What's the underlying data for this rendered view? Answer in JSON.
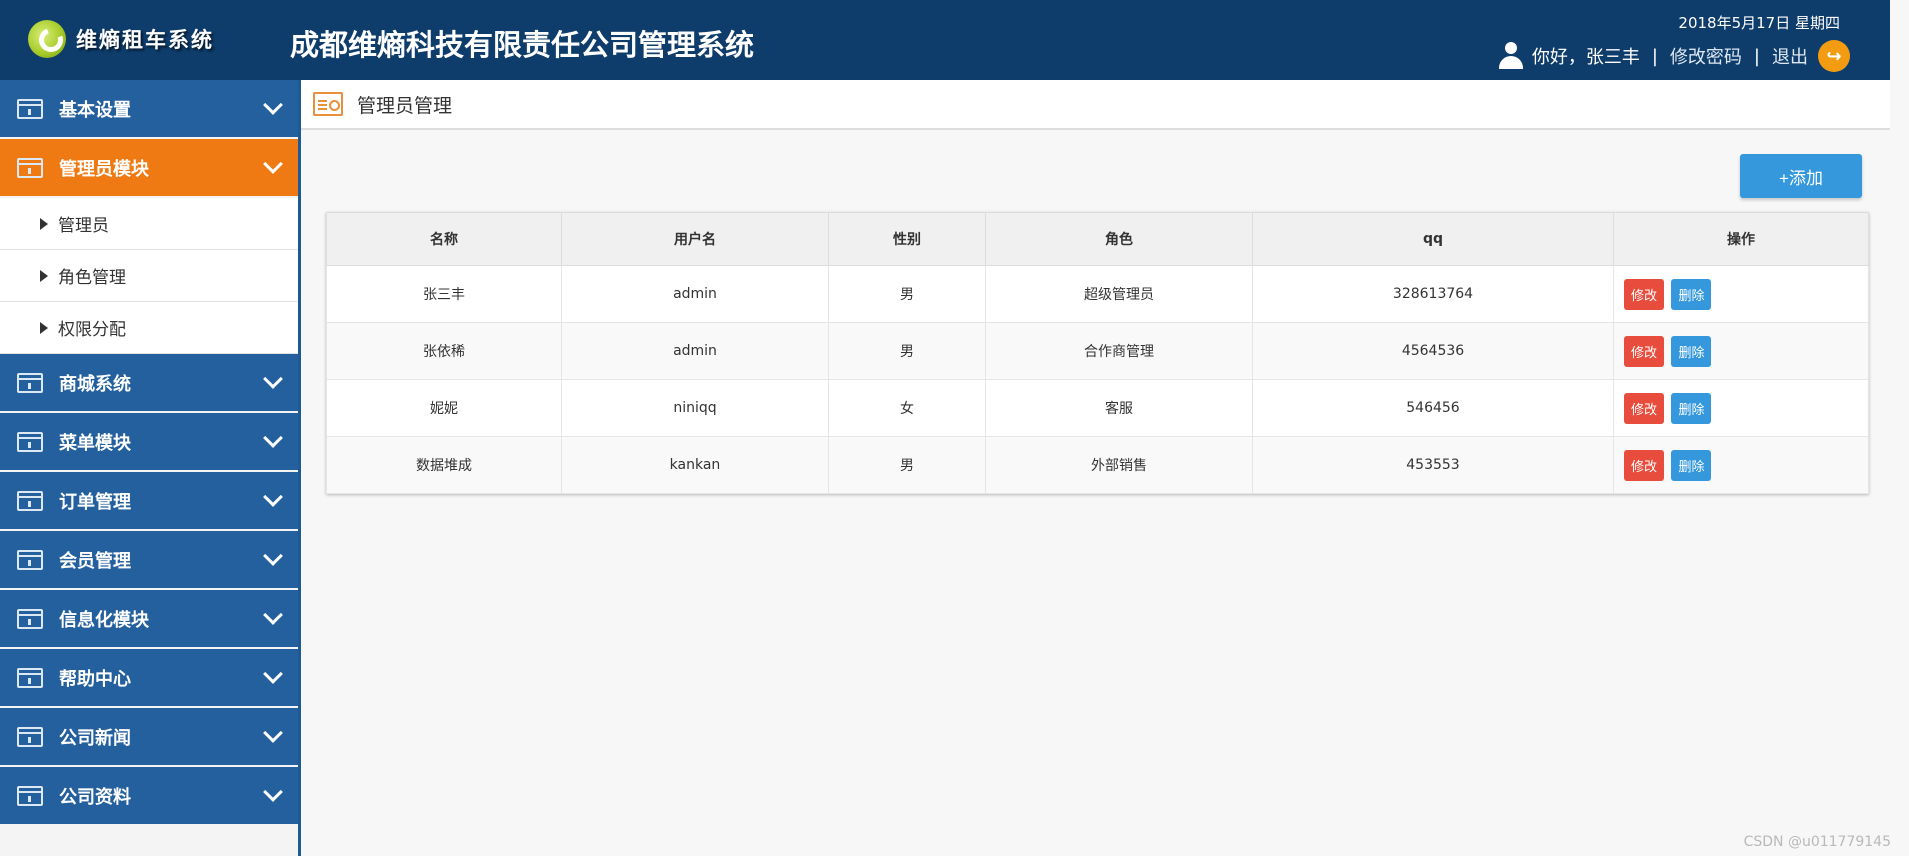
{
  "header": {
    "logo_text": "维熵租车系统",
    "system_title": "成都维熵科技有限责任公司管理系统",
    "date": "2018年5月17日 星期四",
    "greeting": "你好，张三丰",
    "change_password": "修改密码",
    "logout": "退出",
    "separator": "|"
  },
  "sidebar": {
    "menus": [
      {
        "label": "基本设置"
      },
      {
        "label": "管理员模块",
        "active": true
      },
      {
        "label": "商城系统"
      },
      {
        "label": "菜单模块"
      },
      {
        "label": "订单管理"
      },
      {
        "label": "会员管理"
      },
      {
        "label": "信息化模块"
      },
      {
        "label": "帮助中心"
      },
      {
        "label": "公司新闻"
      },
      {
        "label": "公司资料"
      }
    ],
    "submenu": [
      {
        "label": "管理员"
      },
      {
        "label": "角色管理"
      },
      {
        "label": "权限分配"
      }
    ]
  },
  "main": {
    "title": "管理员管理",
    "add_button": "+添加",
    "table": {
      "headers": [
        "名称",
        "用户名",
        "性别",
        "角色",
        "qq",
        "操作"
      ],
      "rows": [
        {
          "name": "张三丰",
          "username": "admin",
          "gender": "男",
          "role": "超级管理员",
          "qq": "328613764"
        },
        {
          "name": "张依稀",
          "username": "admin",
          "gender": "男",
          "role": "合作商管理",
          "qq": "4564536"
        },
        {
          "name": "妮妮",
          "username": "niniqq",
          "gender": "女",
          "role": "客服",
          "qq": "546456"
        },
        {
          "name": "数据堆成",
          "username": "kankan",
          "gender": "男",
          "role": "外部销售",
          "qq": "453553"
        }
      ],
      "edit_label": "修改",
      "delete_label": "删除"
    }
  },
  "watermark": "CSDN @u011779145",
  "colors": {
    "header_bg": "#0e3c6b",
    "menu_bg": "#24609e",
    "menu_active": "#ef7a13",
    "edit_btn": "#e74c3c",
    "primary_btn": "#3598dc",
    "logout_icon": "#f39c12"
  }
}
